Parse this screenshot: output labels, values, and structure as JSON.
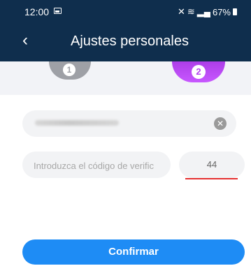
{
  "status_bar": {
    "time": "12:00",
    "battery": "67%"
  },
  "header": {
    "title": "Ajustes personales"
  },
  "steps": [
    {
      "number": "1",
      "state": "completed",
      "color": "#9ea0a6"
    },
    {
      "number": "2",
      "state": "active",
      "color": "#b442f0"
    }
  ],
  "form": {
    "code_placeholder": "Introduzca el código de verific",
    "countdown": "44"
  },
  "actions": {
    "confirm_label": "Confirmar"
  },
  "colors": {
    "header_bg": "#0f2e4d",
    "primary_button": "#1e8cf5",
    "accent_underline": "#e63030"
  }
}
